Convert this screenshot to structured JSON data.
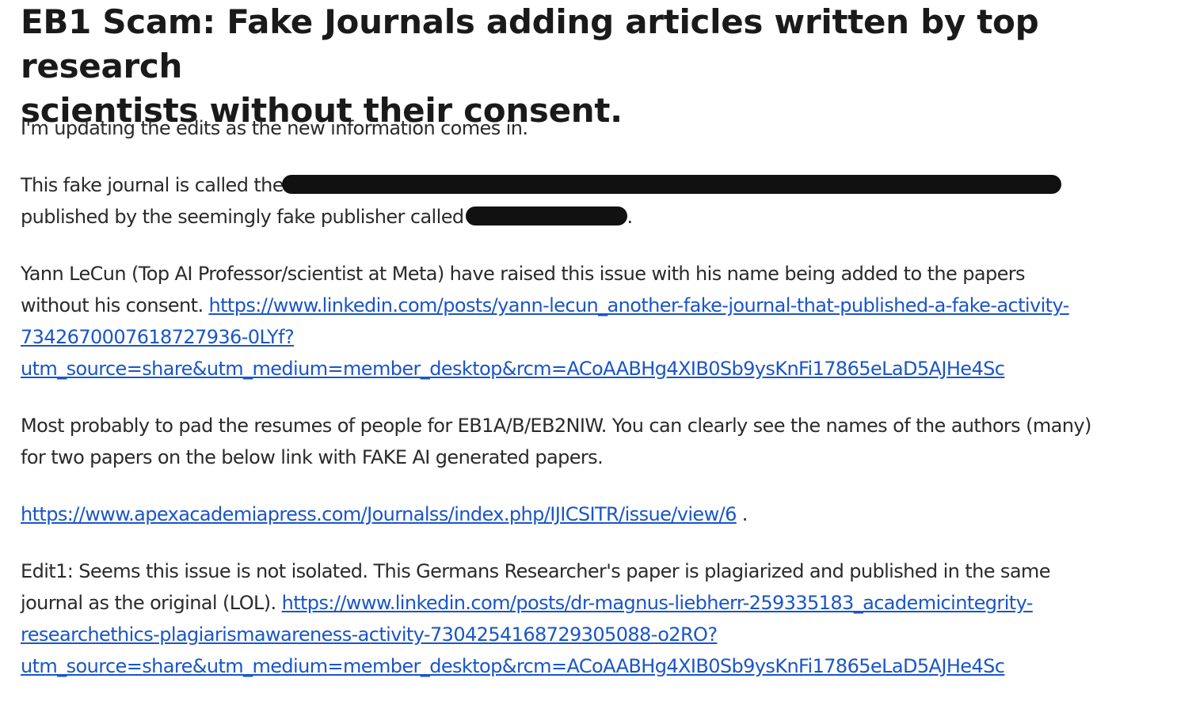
{
  "post": {
    "title_line1": "EB1 Scam: Fake Journals adding articles written by top research",
    "title_line2": "scientists without their consent.",
    "p1": "I'm updating the edits as the new information comes in.",
    "p2_part1": "This fake journal is called the",
    "p2_part2": "published by the seemingly fake publisher called",
    "p2_part3": ".",
    "p3_line1": "Yann LeCun (Top AI Professor/scientist at Meta) have raised this issue with his name being added to the papers",
    "p3_text_before_link": "without his consent. ",
    "p3_link_part1": "https://www.linkedin.com/posts/yann-lecun_another-fake-journal-that-published-a-fake-activity-",
    "p3_link_part2": "7342670007618727936-0LYf?",
    "p3_link_part3": "utm_source=share&utm_medium=member_desktop&rcm=ACoAABHg4XIB0Sb9ysKnFi17865eLaD5AJHe4Sc",
    "p4_line1": "Most probably to pad the resumes of people for EB1A/B/EB2NIW. You can clearly see the names of the authors (many)",
    "p4_line2": "for two papers on the below link with FAKE AI generated papers.",
    "p5_link": "https://www.apexacademiapress.com/Journalss/index.php/IJICSITR/issue/view/6",
    "p5_after": " .",
    "p6_line1": "Edit1: Seems this issue is not isolated. This Germans Researcher's paper is plagiarized and published in the same",
    "p6_text_before_link": "journal as the original (LOL). ",
    "p6_link_part1": "https://www.linkedin.com/posts/dr-magnus-liebherr-259335183_academicintegrity-",
    "p6_link_part2": "researchethics-plagiarismawareness-activity-7304254168729305088-o2RO?",
    "p6_link_part3": "utm_source=share&utm_medium=member_desktop&rcm=ACoAABHg4XIB0Sb9ysKnFi17865eLaD5AJHe4Sc"
  },
  "colors": {
    "text": "#2a2a2a",
    "title": "#1a1a1b",
    "link": "#1a55c8",
    "redaction": "#111111",
    "background": "#ffffff"
  }
}
